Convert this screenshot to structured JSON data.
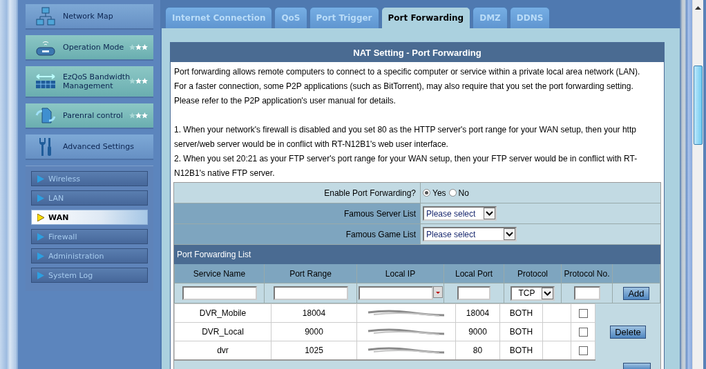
{
  "sidebar": {
    "items": [
      {
        "label": "Network Map",
        "selected": false,
        "kind": "plain"
      },
      {
        "label": "Operation Mode",
        "selected": false,
        "kind": "feature"
      },
      {
        "label": "EzQoS Bandwidth Management",
        "selected": false,
        "kind": "feature"
      },
      {
        "label": "Parenral control",
        "selected": false,
        "kind": "feature"
      },
      {
        "label": "Advanced Settings",
        "selected": false,
        "kind": "plain"
      }
    ],
    "submenu": [
      {
        "label": "Wireless",
        "selected": false
      },
      {
        "label": "LAN",
        "selected": false
      },
      {
        "label": "WAN",
        "selected": true
      },
      {
        "label": "Firewall",
        "selected": false
      },
      {
        "label": "Administration",
        "selected": false
      },
      {
        "label": "System Log",
        "selected": false
      }
    ]
  },
  "tabs": [
    {
      "label": "Internet Connection",
      "selected": false
    },
    {
      "label": "QoS",
      "selected": false
    },
    {
      "label": "Port Trigger",
      "selected": false
    },
    {
      "label": "Port Forwarding",
      "selected": true
    },
    {
      "label": "DMZ",
      "selected": false
    },
    {
      "label": "DDNS",
      "selected": false
    }
  ],
  "panel": {
    "title": "NAT Setting - Port Forwarding",
    "paragraphs": [
      "Port forwarding allows remote computers to connect to a specific computer or service within a private local area network (LAN). For a faster connection, some P2P applications (such as BitTorrent), may also require that you set the port forwarding setting. Please refer to the P2P application's user manual for details.",
      "1. When your network's firewall is disabled and you set 80 as the HTTP server's port range for your WAN setup, then your http server/web server would be in conflict with RT-N12B1's web user interface.\n2. When you set 20:21 as your FTP server's port range for your WAN setup, then your FTP server would be in conflict with RT-N12B1's native FTP server."
    ]
  },
  "enable": {
    "label": "Enable Port Forwarding?",
    "options": [
      {
        "label": "Yes",
        "selected": true
      },
      {
        "label": "No",
        "selected": false
      }
    ]
  },
  "selects": [
    {
      "label": "Famous Server List",
      "value": "Please select",
      "wide": false
    },
    {
      "label": "Famous Game List",
      "value": "Please select",
      "wide": true
    }
  ],
  "list": {
    "title": "Port Forwarding List",
    "columns": [
      "Service Name",
      "Port Range",
      "Local IP",
      "Local Port",
      "Protocol",
      "Protocol No."
    ],
    "new_protocol": "TCP",
    "add_button": "Add",
    "delete_button": "Delete",
    "rows": [
      {
        "service": "DVR_Mobile",
        "port_range": "18004",
        "local_port": "18004",
        "protocol": "BOTH",
        "checked": false
      },
      {
        "service": "DVR_Local",
        "port_range": "9000",
        "local_port": "9000",
        "protocol": "BOTH",
        "checked": false
      },
      {
        "service": "dvr",
        "port_range": "1025",
        "local_port": "80",
        "protocol": "BOTH",
        "checked": false
      }
    ]
  }
}
